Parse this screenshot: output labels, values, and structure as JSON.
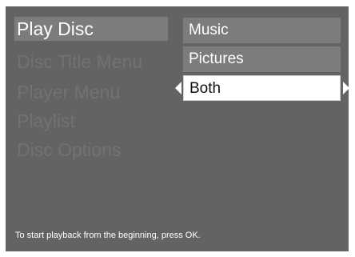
{
  "menu": {
    "items": [
      {
        "label": "Play Disc"
      },
      {
        "label": "Disc Title Menu"
      },
      {
        "label": "Player Menu"
      },
      {
        "label": "Playlist"
      },
      {
        "label": "Disc Options"
      }
    ],
    "selected_index": 0
  },
  "submenu": {
    "options": [
      {
        "label": "Music"
      },
      {
        "label": "Pictures"
      },
      {
        "label": "Both"
      }
    ],
    "selected_index": 2
  },
  "hint": {
    "text": "To start playback from the beginning, press OK."
  },
  "colors": {
    "background": "#636363",
    "selected_background": "#7c7c7c",
    "dim_text": "#727272",
    "active_option_background": "#ffffff"
  }
}
